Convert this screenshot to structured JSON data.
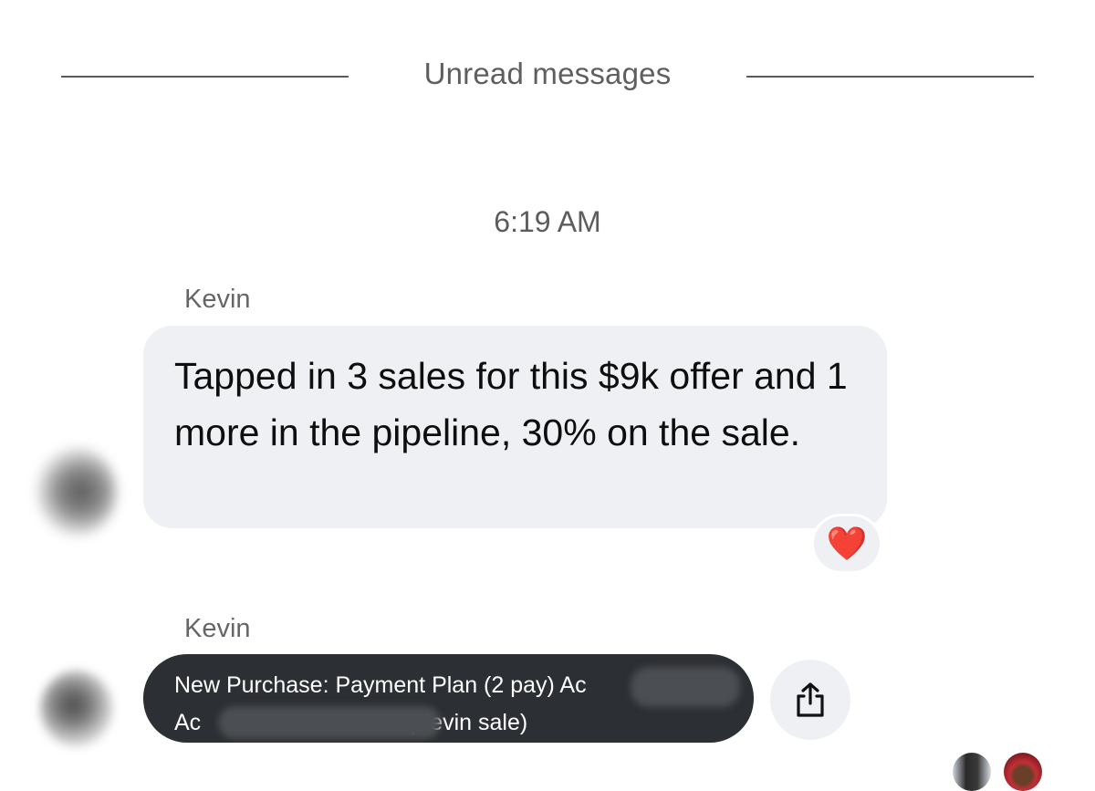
{
  "divider": {
    "label": "Unread messages"
  },
  "timestamp": "6:19 AM",
  "messages": [
    {
      "sender": "Kevin",
      "text": "Tapped in 3 sales for this $9k offer and 1 more in the pipeline, 30% on the sale.",
      "reaction": "❤️"
    },
    {
      "sender": "Kevin",
      "card_line_1": "New Purchase: Payment Plan (2 pay) Ac",
      "card_line_2_start": "Ac",
      "card_line_2_end": "(Kevin sale)"
    }
  ],
  "icons": {
    "share": "share-icon",
    "reaction": "heart-icon"
  },
  "colors": {
    "bubble": "#eef0f4",
    "card": "#2c2f33",
    "heart": "#e0202a"
  }
}
